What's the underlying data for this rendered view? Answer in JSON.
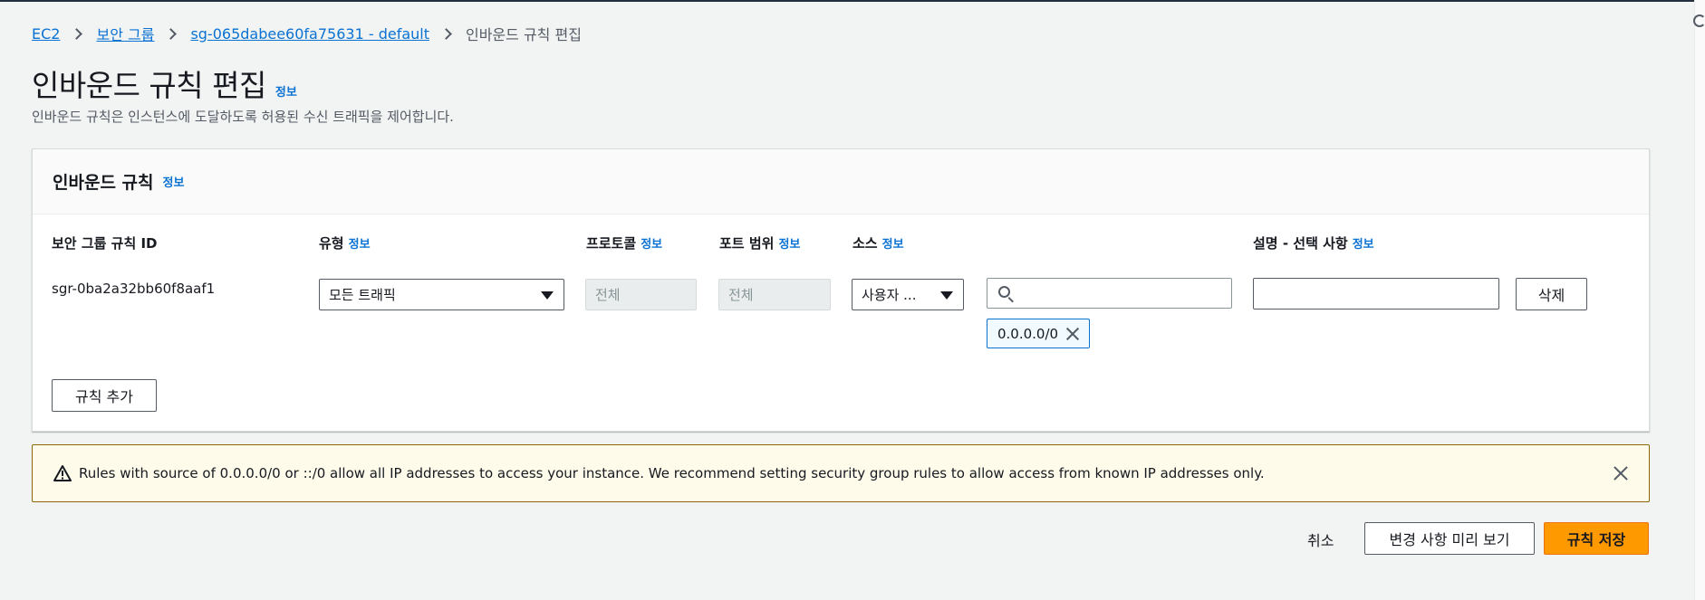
{
  "breadcrumb": {
    "items": [
      "EC2",
      "보안 그룹",
      "sg-065dabee60fa75631 - default"
    ],
    "current": "인바운드 규칙 편집"
  },
  "page": {
    "title": "인바운드 규칙 편집",
    "info": "정보",
    "description": "인바운드 규칙은 인스턴스에 도달하도록 허용된 수신 트래픽을 제어합니다."
  },
  "panel": {
    "title": "인바운드 규칙",
    "info": "정보",
    "columns": [
      {
        "label": "보안 그룹 규칙 ID",
        "info": ""
      },
      {
        "label": "유형",
        "info": "정보"
      },
      {
        "label": "프로토콜",
        "info": "정보"
      },
      {
        "label": "포트 범위",
        "info": "정보"
      },
      {
        "label": "소스",
        "info": "정보"
      },
      {
        "label": "설명 - 선택 사항",
        "info": "정보"
      }
    ],
    "rule": {
      "id": "sgr-0ba2a32bb60f8aaf1",
      "type": "모든 트래픽",
      "protocol_placeholder": "전체",
      "port_placeholder": "전체",
      "source": "사용자 ...",
      "cidr_search_value": "",
      "cidr_token": "0.0.0.0/0",
      "description": "",
      "delete_label": "삭제"
    },
    "add_rule_label": "규칙 추가"
  },
  "alert": {
    "text": "Rules with source of 0.0.0.0/0 or ::/0 allow all IP addresses to access your instance. We recommend setting security group rules to allow access from known IP addresses only."
  },
  "footer": {
    "cancel": "취소",
    "preview": "변경 사항 미리 보기",
    "save": "규칙 저장"
  },
  "colors": {
    "link": "#0972d3",
    "primary": "#ff9900",
    "warning_bg": "#fffbeb",
    "warning_border": "#8d6605"
  }
}
